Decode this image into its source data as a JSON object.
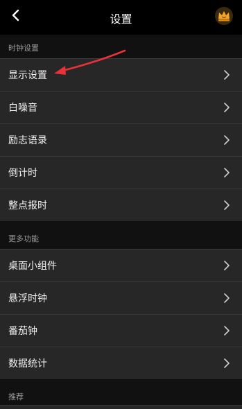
{
  "header": {
    "title": "设置"
  },
  "sections": {
    "clock": {
      "label": "时钟设置",
      "items": [
        "显示设置",
        "白噪音",
        "励志语录",
        "倒计时",
        "整点报时"
      ]
    },
    "more": {
      "label": "更多功能",
      "items": [
        "桌面小组件",
        "悬浮时钟",
        "番茄钟",
        "数据统计"
      ]
    },
    "recommend": {
      "label": "推荐"
    }
  },
  "colors": {
    "background": "#111111",
    "row": "#272727",
    "divider": "#3a3a3a",
    "annotation_arrow": "#e8323a",
    "crown": "#f5a623"
  }
}
